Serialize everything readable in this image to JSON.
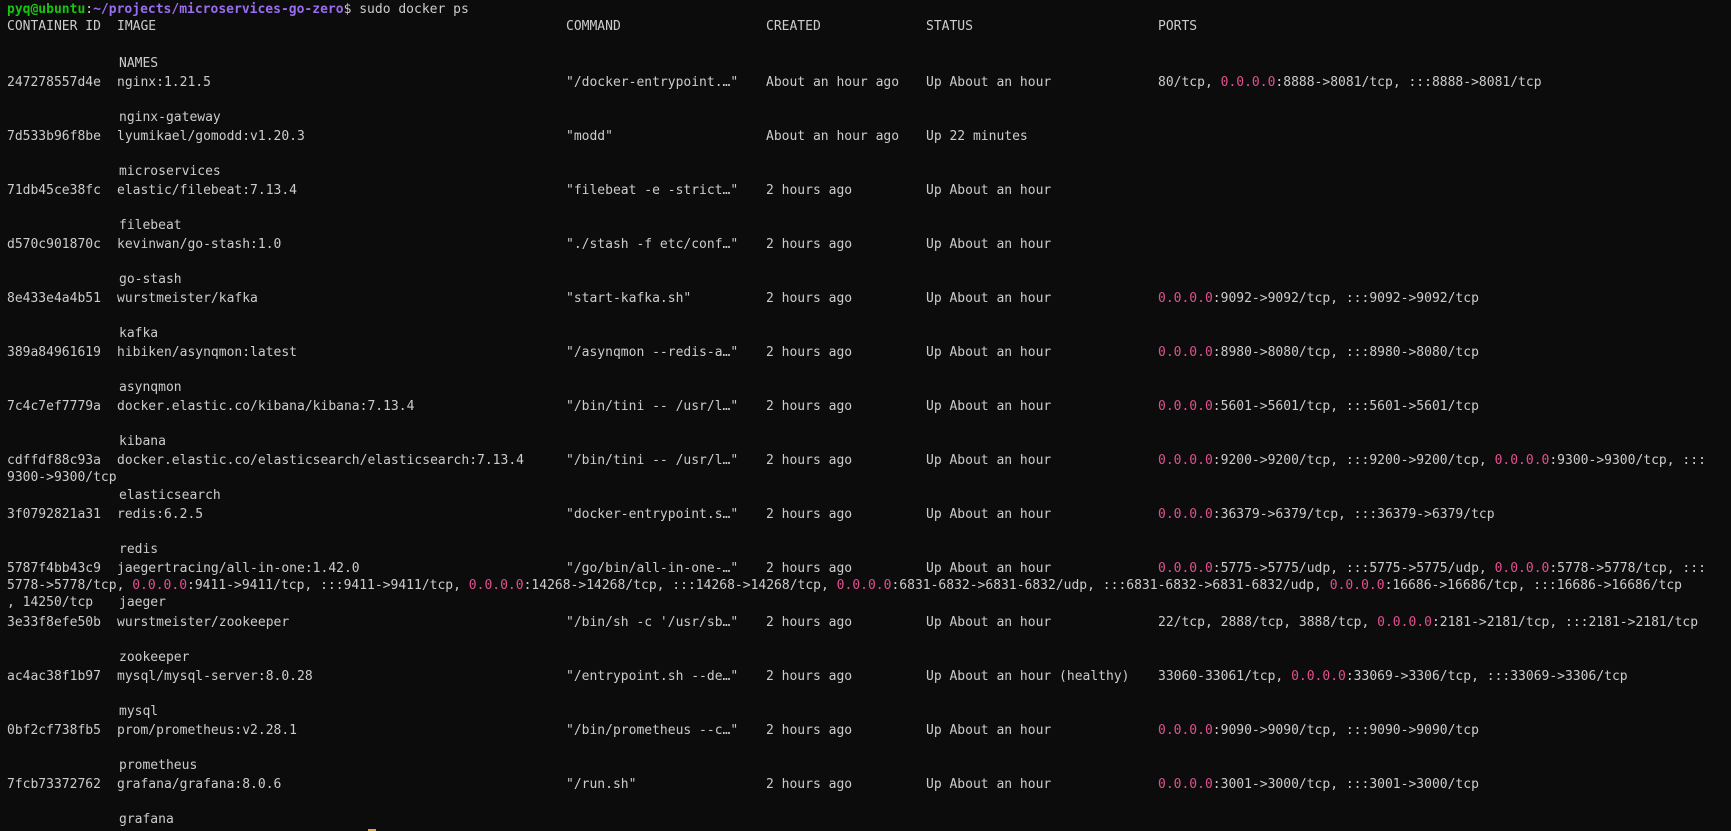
{
  "terminal": {
    "prompt": {
      "user": "pyq@ubuntu",
      "sep": ":",
      "path": "~/projects/microservices-go-zero",
      "symbol": "$",
      "command": "sudo docker ps"
    },
    "headers": [
      "CONTAINER ID",
      "IMAGE",
      "COMMAND",
      "CREATED",
      "STATUS",
      "PORTS"
    ],
    "names_header": "NAMES",
    "ip_color": "#e1508f",
    "rows": [
      {
        "id": "247278557d4e",
        "image": "nginx:1.21.5",
        "command": "\"/docker-entrypoint.…\"",
        "created": "About an hour ago",
        "status": "Up About an hour",
        "ports": [
          [
            {
              "t": "80/tcp, "
            },
            {
              "t": "0.0.0.0",
              "ip": true
            },
            {
              "t": ":8888->8081/tcp, :::8888->8081/tcp"
            }
          ]
        ],
        "name": "nginx-gateway"
      },
      {
        "id": "7d533b96f8be",
        "image": "lyumikael/gomodd:v1.20.3",
        "command": "\"modd\"",
        "created": "About an hour ago",
        "status": "Up 22 minutes",
        "ports": [],
        "name": "microservices"
      },
      {
        "id": "71db45ce38fc",
        "image": "elastic/filebeat:7.13.4",
        "command": "\"filebeat -e -strict…\"",
        "created": "2 hours ago",
        "status": "Up About an hour",
        "ports": [],
        "name": "filebeat"
      },
      {
        "id": "d570c901870c",
        "image": "kevinwan/go-stash:1.0",
        "command": "\"./stash -f etc/conf…\"",
        "created": "2 hours ago",
        "status": "Up About an hour",
        "ports": [],
        "name": "go-stash"
      },
      {
        "id": "8e433e4a4b51",
        "image": "wurstmeister/kafka",
        "command": "\"start-kafka.sh\"",
        "created": "2 hours ago",
        "status": "Up About an hour",
        "ports": [
          [
            {
              "t": "0.0.0.0",
              "ip": true
            },
            {
              "t": ":9092->9092/tcp, :::9092->9092/tcp"
            }
          ]
        ],
        "name": "kafka"
      },
      {
        "id": "389a84961619",
        "image": "hibiken/asynqmon:latest",
        "command": "\"/asynqmon --redis-a…\"",
        "created": "2 hours ago",
        "status": "Up About an hour",
        "ports": [
          [
            {
              "t": "0.0.0.0",
              "ip": true
            },
            {
              "t": ":8980->8080/tcp, :::8980->8080/tcp"
            }
          ]
        ],
        "name": "asynqmon"
      },
      {
        "id": "7c4c7ef7779a",
        "image": "docker.elastic.co/kibana/kibana:7.13.4",
        "command": "\"/bin/tini -- /usr/l…\"",
        "created": "2 hours ago",
        "status": "Up About an hour",
        "ports": [
          [
            {
              "t": "0.0.0.0",
              "ip": true
            },
            {
              "t": ":5601->5601/tcp, :::5601->5601/tcp"
            }
          ]
        ],
        "name": "kibana"
      },
      {
        "id": "cdffdf88c93a",
        "image": "docker.elastic.co/elasticsearch/elasticsearch:7.13.4",
        "command": "\"/bin/tini -- /usr/l…\"",
        "created": "2 hours ago",
        "status": "Up About an hour",
        "ports": [
          [
            {
              "t": "0.0.0.0",
              "ip": true
            },
            {
              "t": ":9200->9200/tcp, :::9200->9200/tcp, "
            },
            {
              "t": "0.0.0.0",
              "ip": true
            },
            {
              "t": ":9300->9300/tcp, :::"
            }
          ],
          [
            {
              "t": "9300->9300/tcp"
            }
          ]
        ],
        "name": "elasticsearch"
      },
      {
        "id": "3f0792821a31",
        "image": "redis:6.2.5",
        "command": "\"docker-entrypoint.s…\"",
        "created": "2 hours ago",
        "status": "Up About an hour",
        "ports": [
          [
            {
              "t": "0.0.0.0",
              "ip": true
            },
            {
              "t": ":36379->6379/tcp, :::36379->6379/tcp"
            }
          ]
        ],
        "name": "redis"
      },
      {
        "id": "5787f4bb43c9",
        "image": "jaegertracing/all-in-one:1.42.0",
        "command": "\"/go/bin/all-in-one-…\"",
        "created": "2 hours ago",
        "status": "Up About an hour",
        "ports": [
          [
            {
              "t": "0.0.0.0",
              "ip": true
            },
            {
              "t": ":5775->5775/udp, :::5775->5775/udp, "
            },
            {
              "t": "0.0.0.0",
              "ip": true
            },
            {
              "t": ":5778->5778/tcp, :::"
            }
          ],
          [
            {
              "t": "5778->5778/tcp, "
            },
            {
              "t": "0.0.0.0",
              "ip": true
            },
            {
              "t": ":9411->9411/tcp, :::9411->9411/tcp, "
            },
            {
              "t": "0.0.0.0",
              "ip": true
            },
            {
              "t": ":14268->14268/tcp, :::14268->14268/tcp, "
            },
            {
              "t": "0.0.0.0",
              "ip": true
            },
            {
              "t": ":6831-6832->6831-6832/udp, :::6831-6832->6831-6832/udp, "
            },
            {
              "t": "0.0.0.0",
              "ip": true
            },
            {
              "t": ":16686->16686/tcp, :::16686->16686/tcp"
            }
          ],
          [
            {
              "t": ", 14250/tcp"
            }
          ]
        ],
        "name": "jaeger"
      },
      {
        "id": "3e33f8efe50b",
        "image": "wurstmeister/zookeeper",
        "command": "\"/bin/sh -c '/usr/sb…\"",
        "created": "2 hours ago",
        "status": "Up About an hour",
        "ports": [
          [
            {
              "t": "22/tcp, 2888/tcp, 3888/tcp, "
            },
            {
              "t": "0.0.0.0",
              "ip": true
            },
            {
              "t": ":2181->2181/tcp, :::2181->2181/tcp"
            }
          ]
        ],
        "name": "zookeeper"
      },
      {
        "id": "ac4ac38f1b97",
        "image": "mysql/mysql-server:8.0.28",
        "command": "\"/entrypoint.sh --de…\"",
        "created": "2 hours ago",
        "status": "Up About an hour (healthy)",
        "ports": [
          [
            {
              "t": "33060-33061/tcp, "
            },
            {
              "t": "0.0.0.0",
              "ip": true
            },
            {
              "t": ":33069->3306/tcp, :::33069->3306/tcp"
            }
          ]
        ],
        "name": "mysql"
      },
      {
        "id": "0bf2cf738fb5",
        "image": "prom/prometheus:v2.28.1",
        "command": "\"/bin/prometheus --c…\"",
        "created": "2 hours ago",
        "status": "Up About an hour",
        "ports": [
          [
            {
              "t": "0.0.0.0",
              "ip": true
            },
            {
              "t": ":9090->9090/tcp, :::9090->9090/tcp"
            }
          ]
        ],
        "name": "prometheus"
      },
      {
        "id": "7fcb73372762",
        "image": "grafana/grafana:8.0.6",
        "command": "\"/run.sh\"",
        "created": "2 hours ago",
        "status": "Up About an hour",
        "ports": [
          [
            {
              "t": "0.0.0.0",
              "ip": true
            },
            {
              "t": ":3001->3000/tcp, :::3001->3000/tcp"
            }
          ]
        ],
        "name": "grafana"
      }
    ]
  }
}
